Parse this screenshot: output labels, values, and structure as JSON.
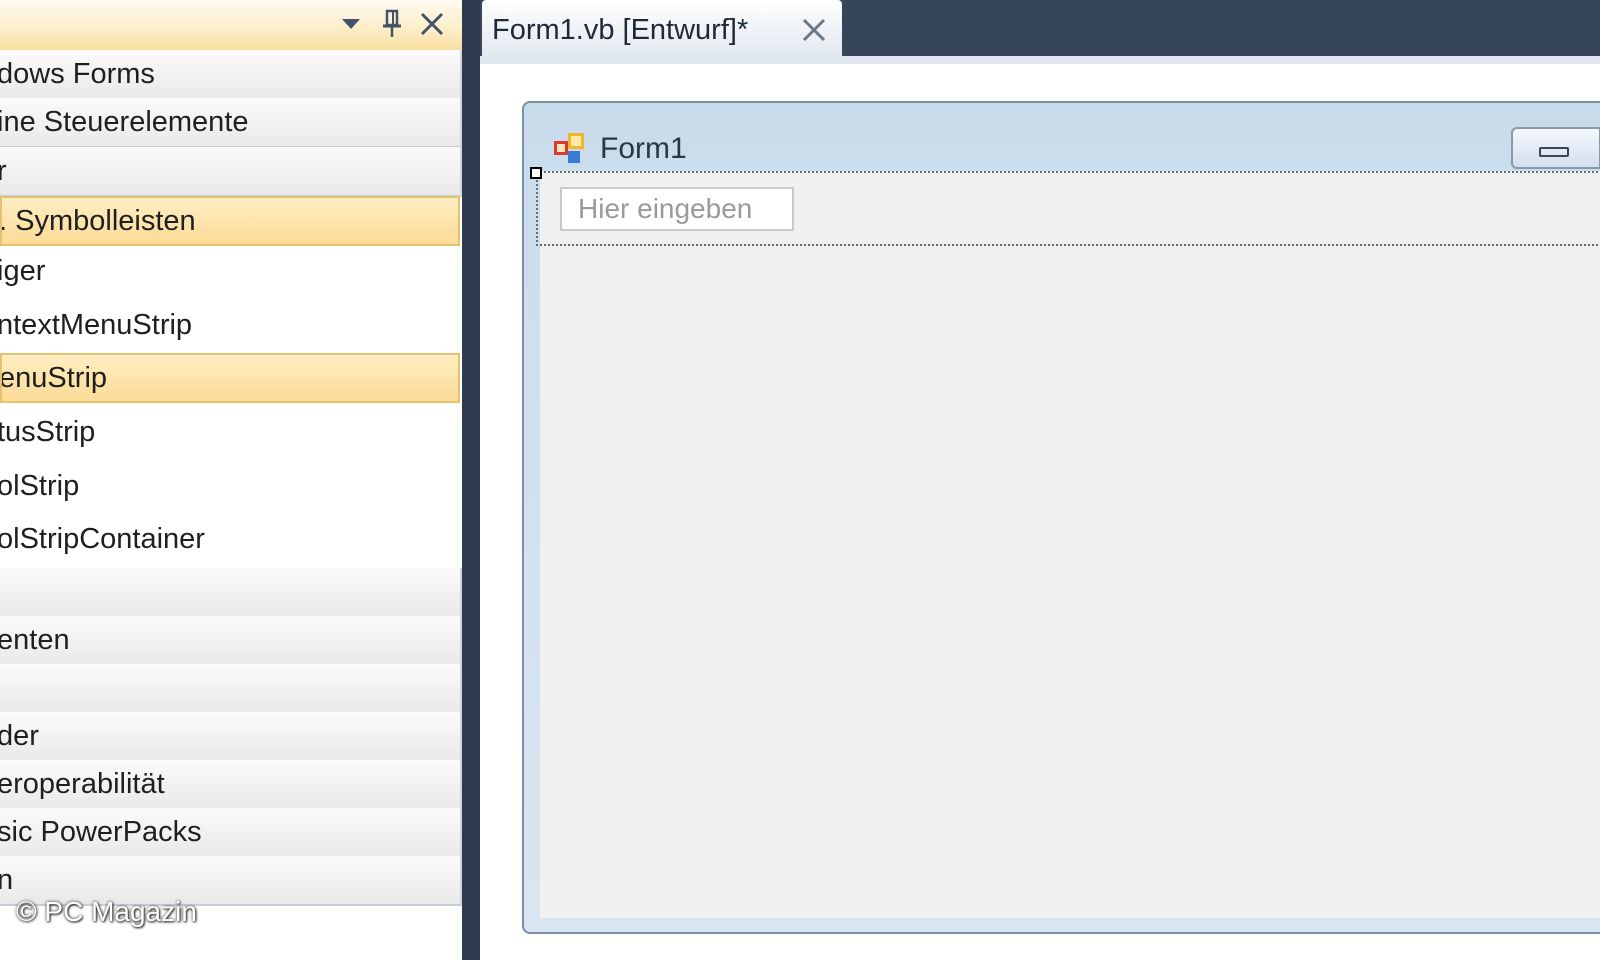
{
  "toolbox": {
    "header_buttons": {
      "dropdown_icon": "chevron-down-icon",
      "pin_icon": "pin-icon",
      "close_icon": "close-icon"
    },
    "rows": [
      {
        "label": "dows Forms",
        "kind": "category"
      },
      {
        "label": "ine Steuerelemente",
        "kind": "category"
      },
      {
        "label": "r",
        "kind": "category"
      },
      {
        "label": ". Symbolleisten",
        "kind": "category-selected"
      },
      {
        "label": "iger",
        "kind": "item"
      },
      {
        "label": "ntextMenuStrip",
        "kind": "item"
      },
      {
        "label": "enuStrip",
        "kind": "item-selected"
      },
      {
        "label": "tusStrip",
        "kind": "item"
      },
      {
        "label": "olStrip",
        "kind": "item"
      },
      {
        "label": "olStripContainer",
        "kind": "item"
      },
      {
        "label": "",
        "kind": "category"
      },
      {
        "label": "enten",
        "kind": "category"
      },
      {
        "label": "",
        "kind": "category"
      },
      {
        "label": "der",
        "kind": "category"
      },
      {
        "label": "eroperabilität",
        "kind": "category"
      },
      {
        "label": "sic PowerPacks",
        "kind": "category"
      },
      {
        "label": "n",
        "kind": "category"
      }
    ]
  },
  "document": {
    "tab_label": "Form1.vb [Entwurf]*",
    "tab_close_icon": "close-icon"
  },
  "form": {
    "title": "Form1",
    "icon": "form-icon",
    "minimize_icon": "minimize-icon",
    "menustrip_placeholder": "Hier eingeben"
  },
  "watermark": "© PC Magazin",
  "colors": {
    "selection_fill": "#fbdb96",
    "selection_border": "#e6c16f",
    "tab_strip": "#36455a",
    "form_client": "#f0f0f0"
  }
}
